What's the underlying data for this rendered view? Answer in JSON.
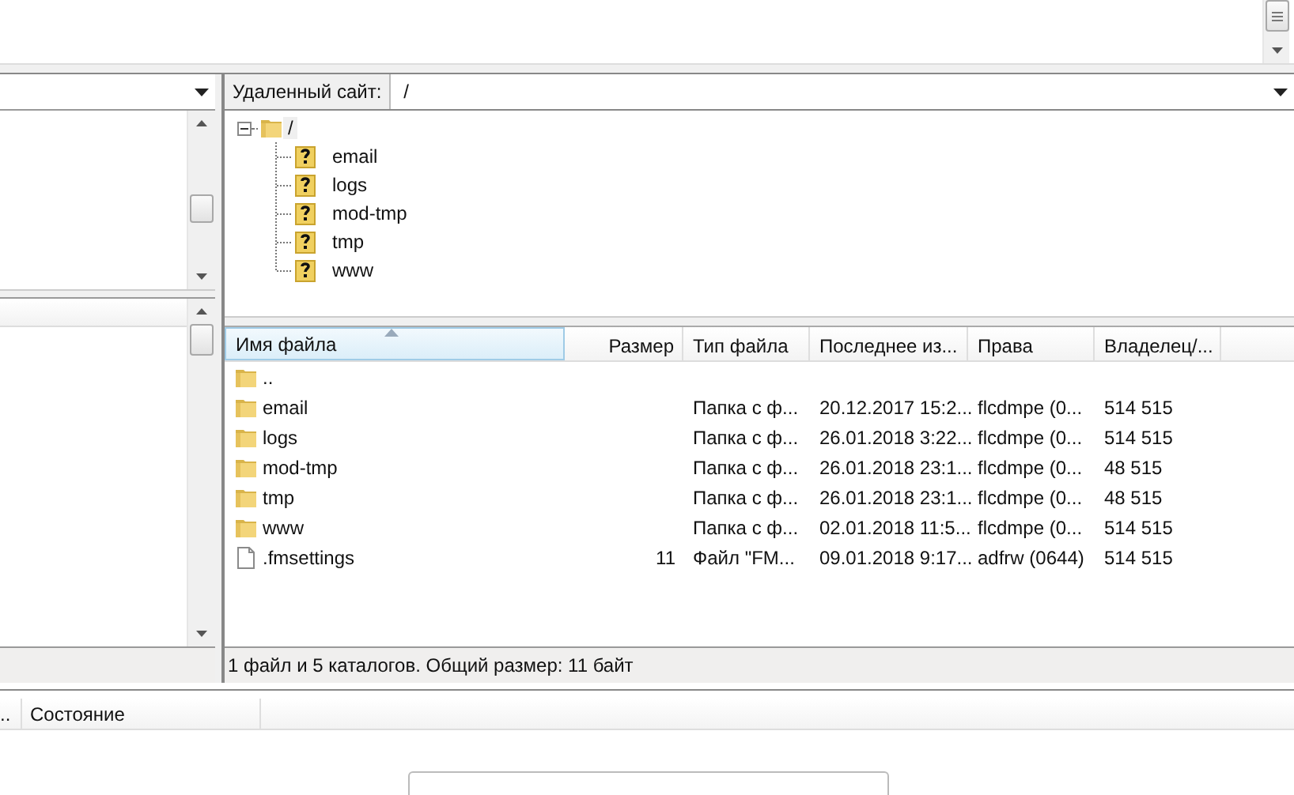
{
  "remote": {
    "label": "Удаленный сайт:",
    "path": "/",
    "tree": {
      "name": "/",
      "expanded": true,
      "children": [
        {
          "name": "email"
        },
        {
          "name": "logs"
        },
        {
          "name": "mod-tmp"
        },
        {
          "name": "tmp"
        },
        {
          "name": "www"
        }
      ]
    }
  },
  "listing": {
    "columns": [
      {
        "label": "Имя файла",
        "sorted": true
      },
      {
        "label": "Размер",
        "sorted": false
      },
      {
        "label": "Тип файла",
        "sorted": false
      },
      {
        "label": "Последнее из...",
        "sorted": false
      },
      {
        "label": "Права",
        "sorted": false
      },
      {
        "label": "Владелец/...",
        "sorted": false
      }
    ],
    "rows": [
      {
        "kind": "folder",
        "name": ".."
      },
      {
        "kind": "folder",
        "name": "email",
        "type": "Папка с ф...",
        "modified": "20.12.2017 15:2...",
        "rights": "flcdmpe (0...",
        "owner": "514 515"
      },
      {
        "kind": "folder",
        "name": "logs",
        "type": "Папка с ф...",
        "modified": "26.01.2018 3:22...",
        "rights": "flcdmpe (0...",
        "owner": "514 515"
      },
      {
        "kind": "folder",
        "name": "mod-tmp",
        "type": "Папка с ф...",
        "modified": "26.01.2018 23:1...",
        "rights": "flcdmpe (0...",
        "owner": "48 515"
      },
      {
        "kind": "folder",
        "name": "tmp",
        "type": "Папка с ф...",
        "modified": "26.01.2018 23:1...",
        "rights": "flcdmpe (0...",
        "owner": "48 515"
      },
      {
        "kind": "folder",
        "name": "www",
        "type": "Папка с ф...",
        "modified": "02.01.2018 11:5...",
        "rights": "flcdmpe (0...",
        "owner": "514 515"
      },
      {
        "kind": "file",
        "name": ".fmsettings",
        "size": "11",
        "type": "Файл \"FM...",
        "modified": "09.01.2018 9:17...",
        "rights": "adfrw (0644)",
        "owner": "514 515"
      }
    ],
    "status": "1 файл и 5 каталогов. Общий размер: 11 байт"
  },
  "queue": {
    "columns": [
      "..",
      "Состояние"
    ]
  }
}
